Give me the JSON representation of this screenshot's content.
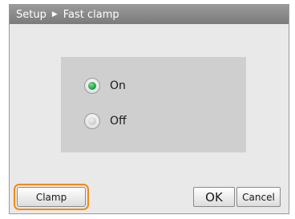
{
  "dialog": {
    "breadcrumb": {
      "root": "Setup",
      "current": "Fast clamp",
      "separator_icon": "triangle-right-icon"
    },
    "options": [
      {
        "label": "On",
        "selected": true
      },
      {
        "label": "Off",
        "selected": false
      }
    ],
    "buttons": {
      "clamp": "Clamp",
      "ok": "OK",
      "cancel": "Cancel"
    },
    "colors": {
      "title_bar": "#8a8a8a",
      "panel": "#cfcfcf",
      "selected_radio": "#1fa14b",
      "focus_highlight": "#f08a12"
    }
  }
}
